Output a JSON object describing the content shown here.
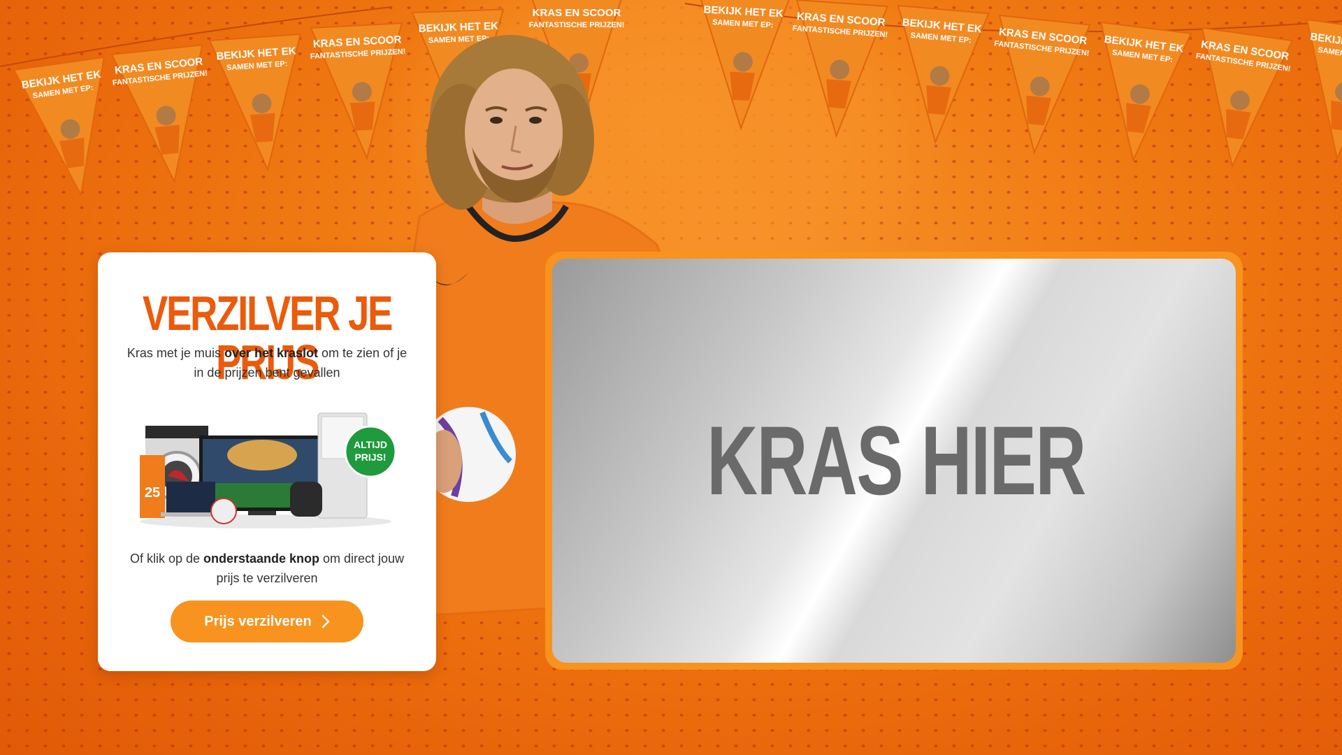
{
  "card": {
    "title": "VERZILVER JE PRIJS",
    "intro_part1": "Kras met je muis ",
    "intro_bold": "over het kraslot",
    "intro_part2": " om te zien of je in de prijzen bent gevallen",
    "prizes_badge_line1": "ALTIJD",
    "prizes_badge_line2": "PRIJS!",
    "outro_part1": "Of klik op de ",
    "outro_bold": "onderstaande knop",
    "outro_part2": " om direct jouw prijs te verzilveren",
    "button_label": "Prijs verzilveren"
  },
  "scratch": {
    "label": "KRAS HIER"
  },
  "bunting": {
    "flag_texts": [
      [
        "BEKIJK HET EK",
        "SAMEN MET EP:"
      ],
      [
        "KRAS EN SCOOR",
        "FANTASTISCHE PRIJZEN!"
      ]
    ]
  },
  "colors": {
    "brand_orange": "#f7931e",
    "title_orange": "#ea5b0c",
    "background": "#f07a12",
    "scratch_text": "#6a6a6a"
  }
}
